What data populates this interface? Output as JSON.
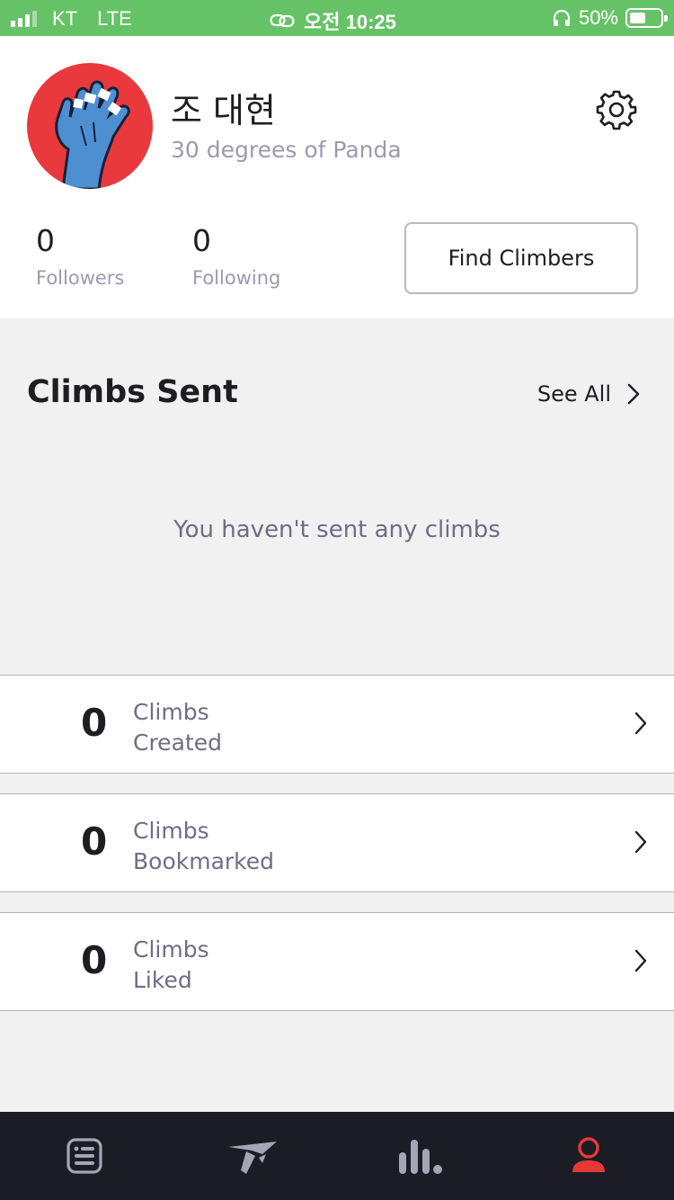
{
  "status_bar": {
    "carrier": "KT",
    "network": "LTE",
    "time": "오전 10:25",
    "battery": "50%"
  },
  "profile": {
    "name": "조 대현",
    "subtitle": "30 degrees of Panda",
    "followers_count": "0",
    "followers_label": "Followers",
    "following_count": "0",
    "following_label": "Following",
    "find_climbers_label": "Find Climbers"
  },
  "climbs_sent": {
    "title": "Climbs Sent",
    "see_all_label": "See All",
    "empty_message": "You haven't sent any climbs"
  },
  "stats_rows": [
    {
      "count": "0",
      "line1": "Climbs",
      "line2": "Created"
    },
    {
      "count": "0",
      "line1": "Climbs",
      "line2": "Bookmarked"
    },
    {
      "count": "0",
      "line1": "Climbs",
      "line2": "Liked"
    }
  ],
  "tab_bar": {
    "tabs": [
      "feed-icon",
      "climbs-icon",
      "stats-icon",
      "profile-icon"
    ],
    "active_tab": "profile-icon",
    "active_color": "#e53935"
  },
  "colors": {
    "status_bar": "#66c266",
    "avatar_bg": "#e9393c",
    "tab_bar_bg": "#1c1c24"
  }
}
